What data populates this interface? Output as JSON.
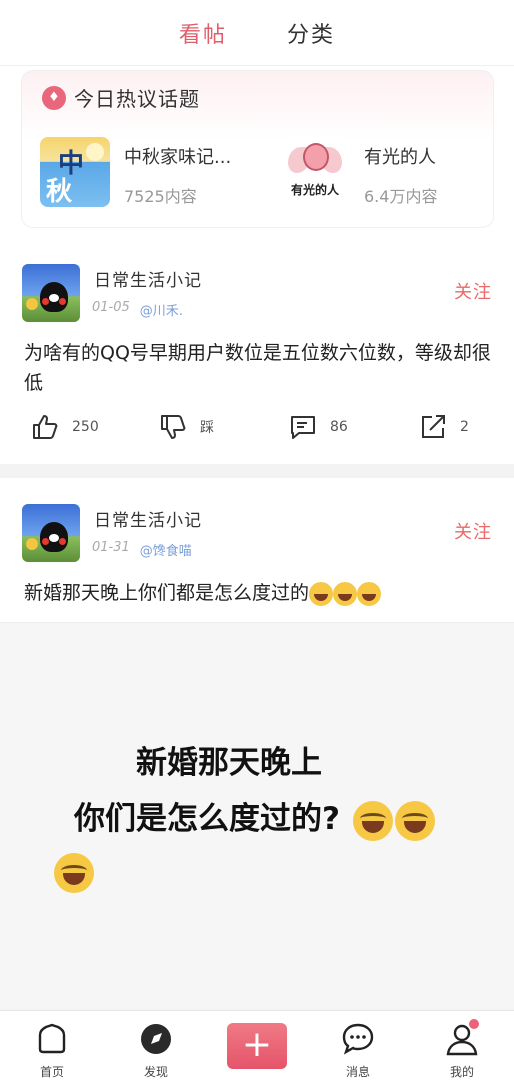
{
  "top_tabs": [
    {
      "label": "看帖",
      "active": true
    },
    {
      "label": "分类",
      "active": false
    }
  ],
  "hot_topics": {
    "title": "今日热议话题",
    "items": [
      {
        "name": "中秋家味记...",
        "count": "7525内容",
        "thumb_text_1": "中",
        "thumb_text_2": "秋"
      },
      {
        "name": "有光的人",
        "count": "6.4万内容",
        "thumb_text": "有光的人"
      }
    ]
  },
  "posts": [
    {
      "author": "日常生活小记",
      "date": "01-05",
      "mention": "@川禾.",
      "follow_label": "关注",
      "text": "为啥有的QQ号早期用户数位是五位数六位数，等级却很低",
      "likes": "250",
      "dislike_label": "踩",
      "comments": "86",
      "shares": "2"
    },
    {
      "author": "日常生活小记",
      "date": "01-31",
      "mention": "@馋食喵",
      "follow_label": "关注",
      "text": "新婚那天晚上你们都是怎么度过的",
      "image_line_1": "新婚那天晚上",
      "image_line_2": "你们是怎么度过的?"
    }
  ],
  "bottom_nav": [
    {
      "label": "首页",
      "icon": "home-icon"
    },
    {
      "label": "发现",
      "icon": "compass-icon"
    },
    {
      "label": "",
      "icon": "plus-icon"
    },
    {
      "label": "消息",
      "icon": "message-icon"
    },
    {
      "label": "我的",
      "icon": "user-icon"
    }
  ],
  "colors": {
    "accent": "#e05d6b",
    "follow": "#e86a6a",
    "mention": "#7b9fd8"
  }
}
